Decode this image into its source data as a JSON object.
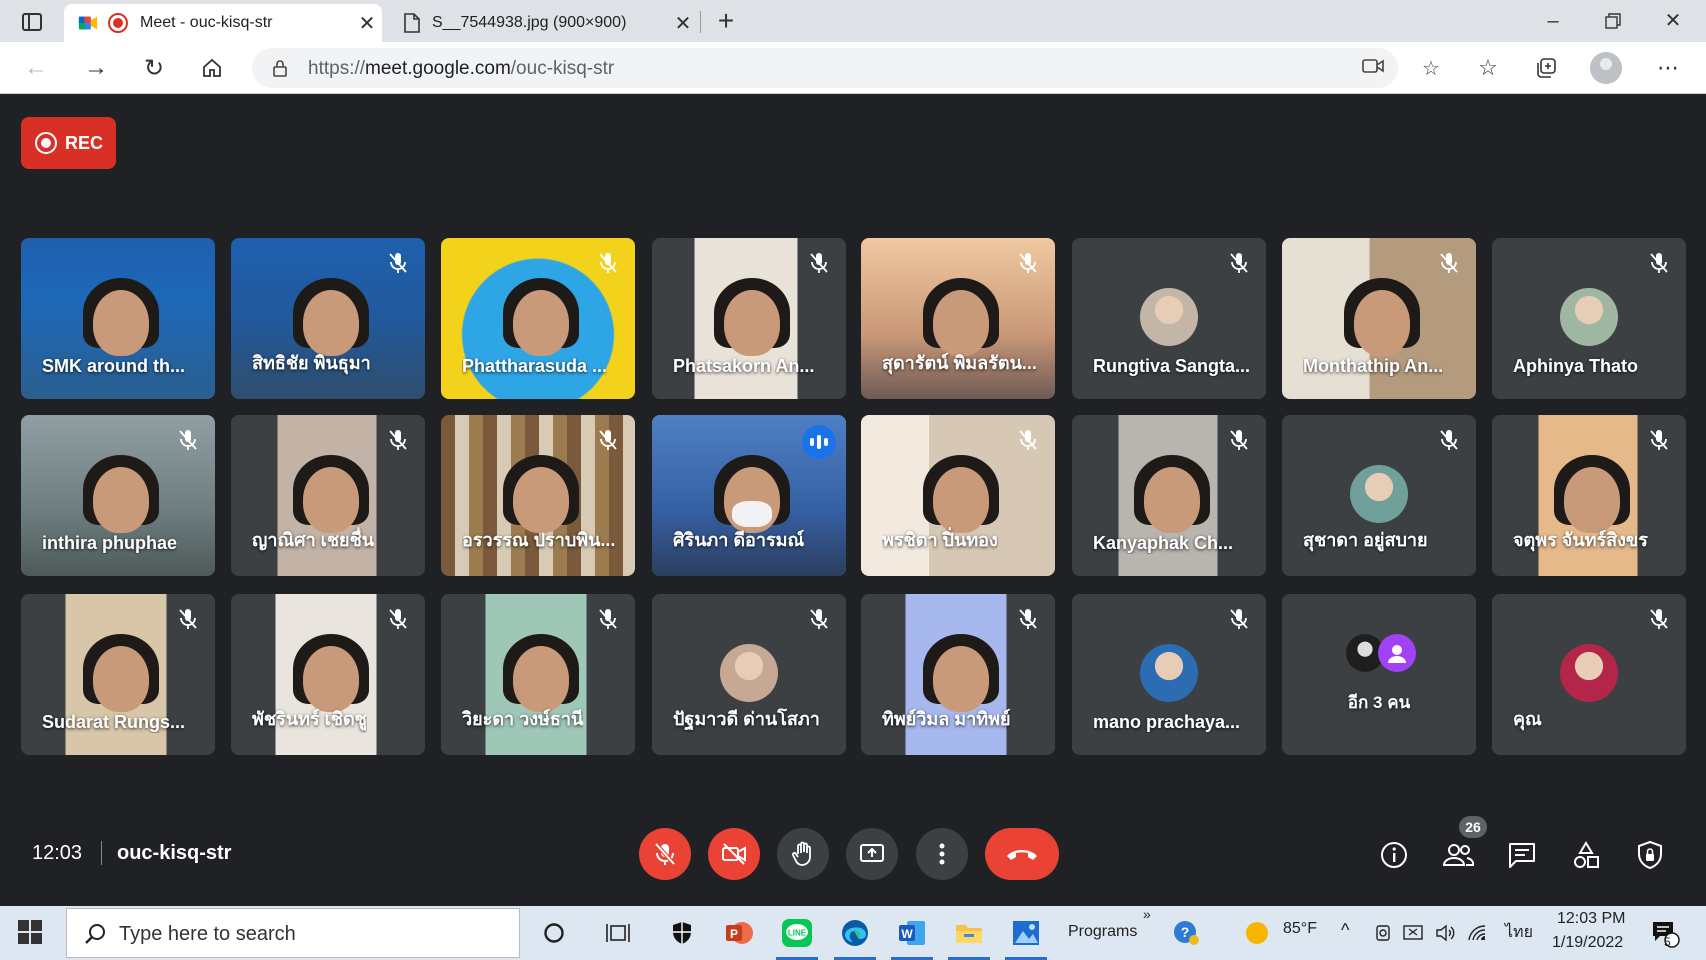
{
  "browser": {
    "tabs": [
      {
        "title": "Meet - ouc-kisq-str",
        "active": true
      },
      {
        "title": "S__7544938.jpg (900×900)",
        "active": false
      }
    ],
    "url_prefix": "https://",
    "url_host": "meet.google.com",
    "url_path": "/ouc-kisq-str"
  },
  "meet": {
    "rec_label": "REC",
    "time": "12:03",
    "meeting_code": "ouc-kisq-str",
    "participant_count": "26",
    "tiles": [
      {
        "name": "SMK around th..."
      },
      {
        "name": "สิทธิชัย พินธุมา"
      },
      {
        "name": "Phattharasuda ..."
      },
      {
        "name": "Phatsakorn An..."
      },
      {
        "name": "สุดารัตน์ พิมลรัตน..."
      },
      {
        "name": "Rungtiva Sangta..."
      },
      {
        "name": "Monthathip An..."
      },
      {
        "name": "Aphinya Thato"
      },
      {
        "name": "inthira phuphae"
      },
      {
        "name": "ญาณิศา เชยชื่น"
      },
      {
        "name": "อรวรรณ ปราบพิน..."
      },
      {
        "name": "ศิรินภา ดีอารมณ์"
      },
      {
        "name": "พรชิตา ปิ่นทอง"
      },
      {
        "name": "Kanyaphak Ch..."
      },
      {
        "name": "สุชาดา อยู่สบาย"
      },
      {
        "name": "จตุพร จันทร์สิงขร"
      },
      {
        "name": "Sudarat Rungs..."
      },
      {
        "name": "พัชรินทร์ เชิดชู"
      },
      {
        "name": "วิยะดา วงษ์ธานี"
      },
      {
        "name": "ปัฐมาวดี ด่านโสภา"
      },
      {
        "name": "ทิพย์วิมล มาทิพย์"
      },
      {
        "name": "mano prachaya..."
      },
      {
        "name": "อีก 3 คน"
      },
      {
        "name": "คุณ"
      }
    ]
  },
  "taskbar": {
    "search_placeholder": "Type here to search",
    "programs_label": "Programs",
    "temperature": "85°F",
    "language": "ไทย",
    "time": "12:03 PM",
    "date": "1/19/2022",
    "notification_count": "5"
  },
  "colors": {
    "meet_bg": "#202124",
    "tile_bg": "#3c4043",
    "danger_red": "#ea4335",
    "speaker_blue": "#8ab4f8"
  }
}
